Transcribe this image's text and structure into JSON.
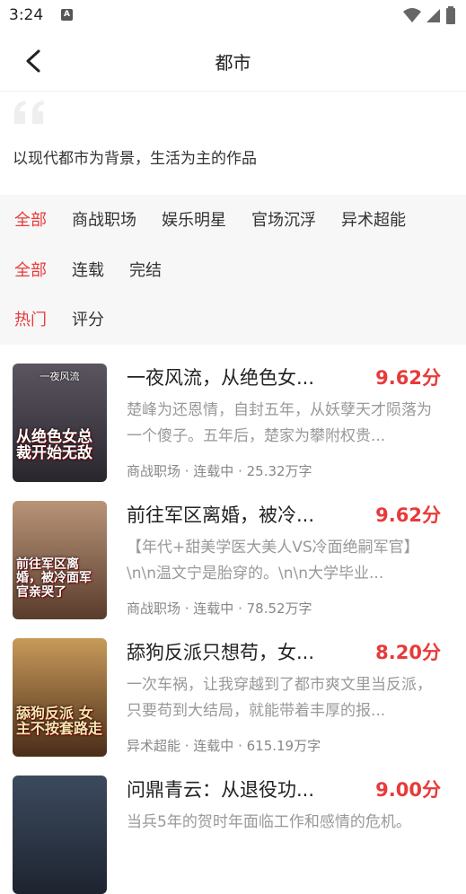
{
  "status": {
    "time": "3:24",
    "a_badge": "A"
  },
  "appbar": {
    "title": "都市"
  },
  "intro": {
    "description": "以现代都市为背景，生活为主的作品"
  },
  "filters": {
    "category": [
      "全部",
      "商战职场",
      "娱乐明星",
      "官场沉浮",
      "异术超能"
    ],
    "status": [
      "全部",
      "连载",
      "完结"
    ],
    "sort": [
      "热门",
      "评分"
    ]
  },
  "books": [
    {
      "title": "一夜风流，从绝色女...",
      "score": "9.62分",
      "summary": "楚峰为还恩情，自封五年，从妖孽天才陨落为一个傻子。五年后，楚家为攀附权贵...",
      "meta": "商战职场 · 连载中 · 25.32万字",
      "cover_text": "从绝色女总裁开始无敌",
      "cover_top": "一夜风流",
      "cover_bg": "#3a3640"
    },
    {
      "title": "前往军区离婚，被冷...",
      "score": "9.62分",
      "summary": "【年代+甜美学医大美人VS冷面绝嗣军官】\\n\\n温文宁是胎穿的。\\n\\n大学毕业...",
      "meta": "商战职场 · 连载中 · 78.52万字",
      "cover_text": "前往军区离婚，被冷面军官亲哭了",
      "cover_top": "",
      "cover_bg": "#7a5a48"
    },
    {
      "title": "舔狗反派只想苟，女...",
      "score": "8.20分",
      "summary": "一次车祸，让我穿越到了都市爽文里当反派，只要苟到大结局，就能带着丰厚的报...",
      "meta": "异术超能 · 连载中 · 615.19万字",
      "cover_text": "舔狗反派 女主不按套路走",
      "cover_top": "",
      "cover_bg": "#6b4a2e"
    },
    {
      "title": "问鼎青云：从退役功...",
      "score": "9.00分",
      "summary": "当兵5年的贺时年面临工作和感情的危机。",
      "meta": "",
      "cover_text": "",
      "cover_top": "",
      "cover_bg": "#2d3a4c"
    }
  ]
}
